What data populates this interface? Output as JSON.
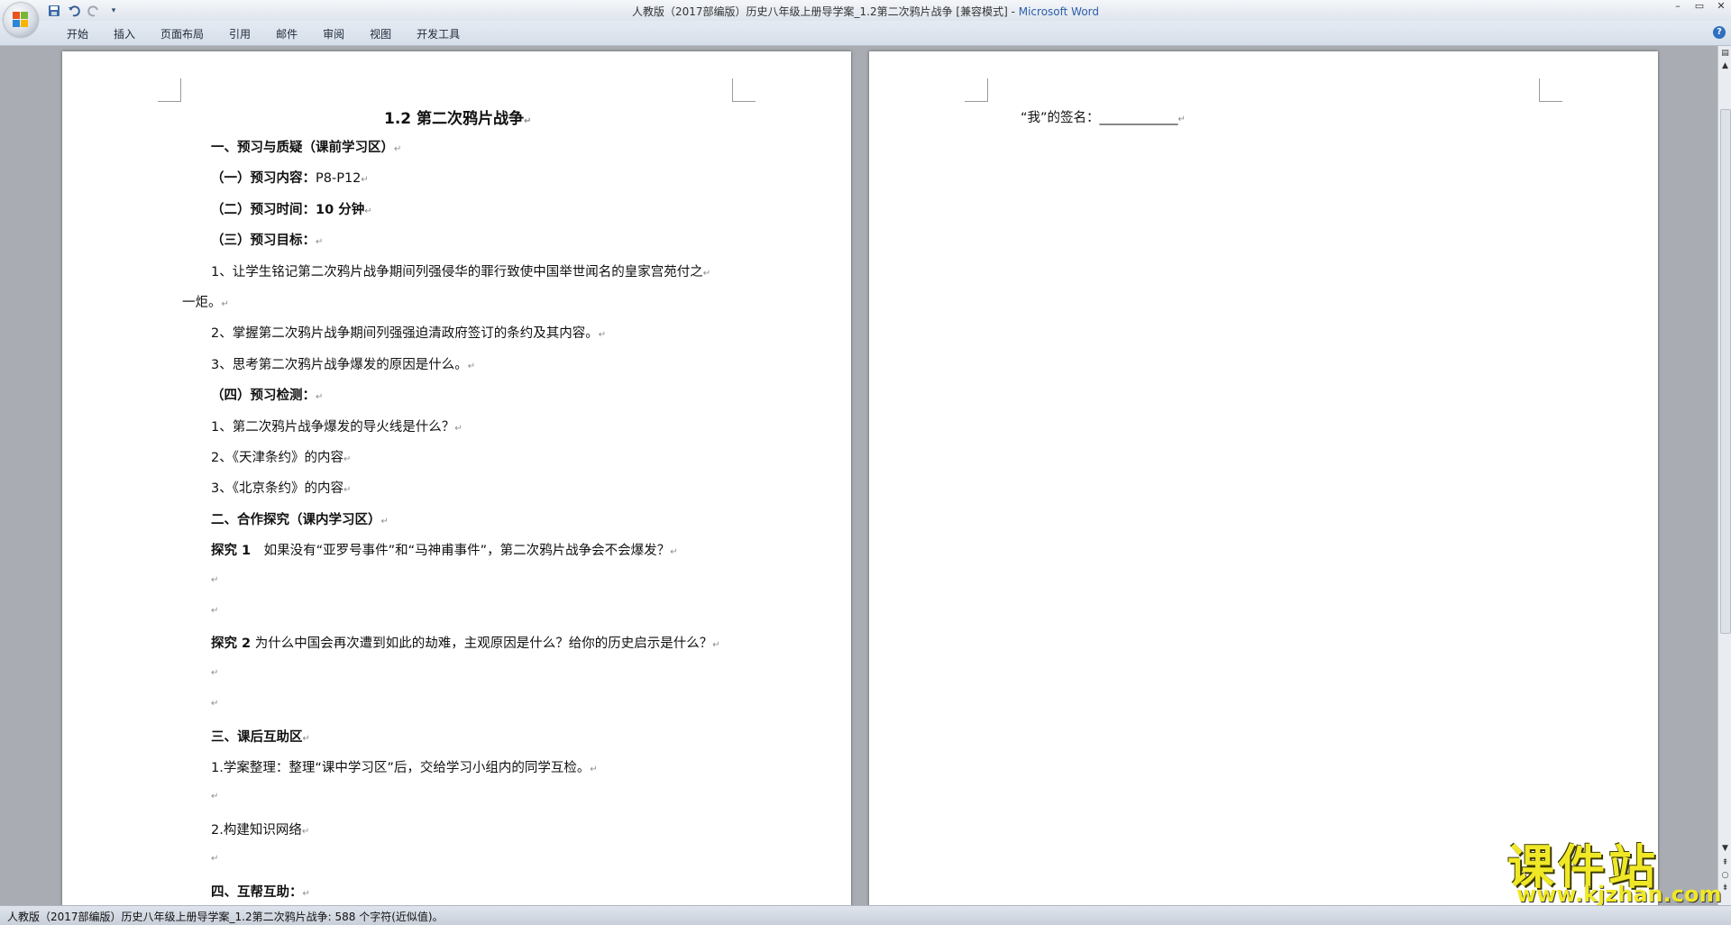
{
  "window": {
    "title": "人教版（2017部编版）历史八年级上册导学案_1.2第二次鸦片战争 [兼容模式] - ",
    "app_name": "Microsoft Word",
    "controls": [
      "–",
      "▭",
      "✕"
    ]
  },
  "quick_access": {
    "icons": [
      "save-icon",
      "undo-icon",
      "redo-icon",
      "customize-icon"
    ]
  },
  "ribbon": {
    "tabs": [
      "开始",
      "插入",
      "页面布局",
      "引用",
      "邮件",
      "审阅",
      "视图",
      "开发工具"
    ]
  },
  "document": {
    "page1": {
      "heading": "1.2 第二次鸦片战争",
      "lines": [
        {
          "text": "一、预习与质疑（课前学习区）",
          "bold": true
        },
        {
          "text": "（一）预习内容：",
          "bold": true,
          "extra": "P8-P12"
        },
        {
          "text": "（二）预习时间：10 分钟",
          "bold": true
        },
        {
          "text": "（三）预习目标：",
          "bold": true
        },
        {
          "text": "1、让学生铭记第二次鸦片战争期间列强侵华的罪行致使中国举世闻名的皇家宫苑付之",
          "bold": false
        },
        {
          "text": "一炬。",
          "bold": false
        },
        {
          "text": "2、掌握第二次鸦片战争期间列强强迫清政府签订的条约及其内容。",
          "bold": false
        },
        {
          "text": "3、思考第二次鸦片战争爆发的原因是什么。",
          "bold": false
        },
        {
          "text": "（四）预习检测：",
          "bold": true
        },
        {
          "text": "1、第二次鸦片战争爆发的导火线是什么？",
          "bold": false
        },
        {
          "text": "2、《天津条约》的内容",
          "bold": false
        },
        {
          "text": "3、《北京条约》的内容",
          "bold": false
        },
        {
          "text": "二、合作探究（课内学习区）",
          "bold": true
        },
        {
          "text": "探究 1",
          "bold": true,
          "extra": "　如果没有“亚罗号事件”和“马神甫事件”，第二次鸦片战争会不会爆发？"
        },
        {
          "text": "",
          "bold": false
        },
        {
          "text": "",
          "bold": false
        },
        {
          "text": "探究 2",
          "bold": true,
          "extra": " 为什么中国会再次遭到如此的劫难，主观原因是什么？给你的历史启示是什么？"
        },
        {
          "text": "",
          "bold": false
        },
        {
          "text": "",
          "bold": false
        },
        {
          "text": "三、课后互助区",
          "bold": true
        },
        {
          "text": "1.学案整理：整理“课中学习区”后，交给学习小组内的同学互检。",
          "bold": false
        },
        {
          "text": "",
          "bold": false
        },
        {
          "text": "2.构建知识网络",
          "bold": false
        },
        {
          "text": "",
          "bold": false
        },
        {
          "text": "四、互帮互助：",
          "bold": true
        }
      ]
    },
    "page2": {
      "signature_line": "“我”的签名：____________"
    },
    "paragraph_mark": "↵"
  },
  "status": {
    "text": "人教版（2017部编版）历史八年级上册导学案_1.2第二次鸦片战争: 588 个字符(近似值)。"
  },
  "watermark": {
    "name": "课件站",
    "url": "www.kjzhan.com"
  }
}
